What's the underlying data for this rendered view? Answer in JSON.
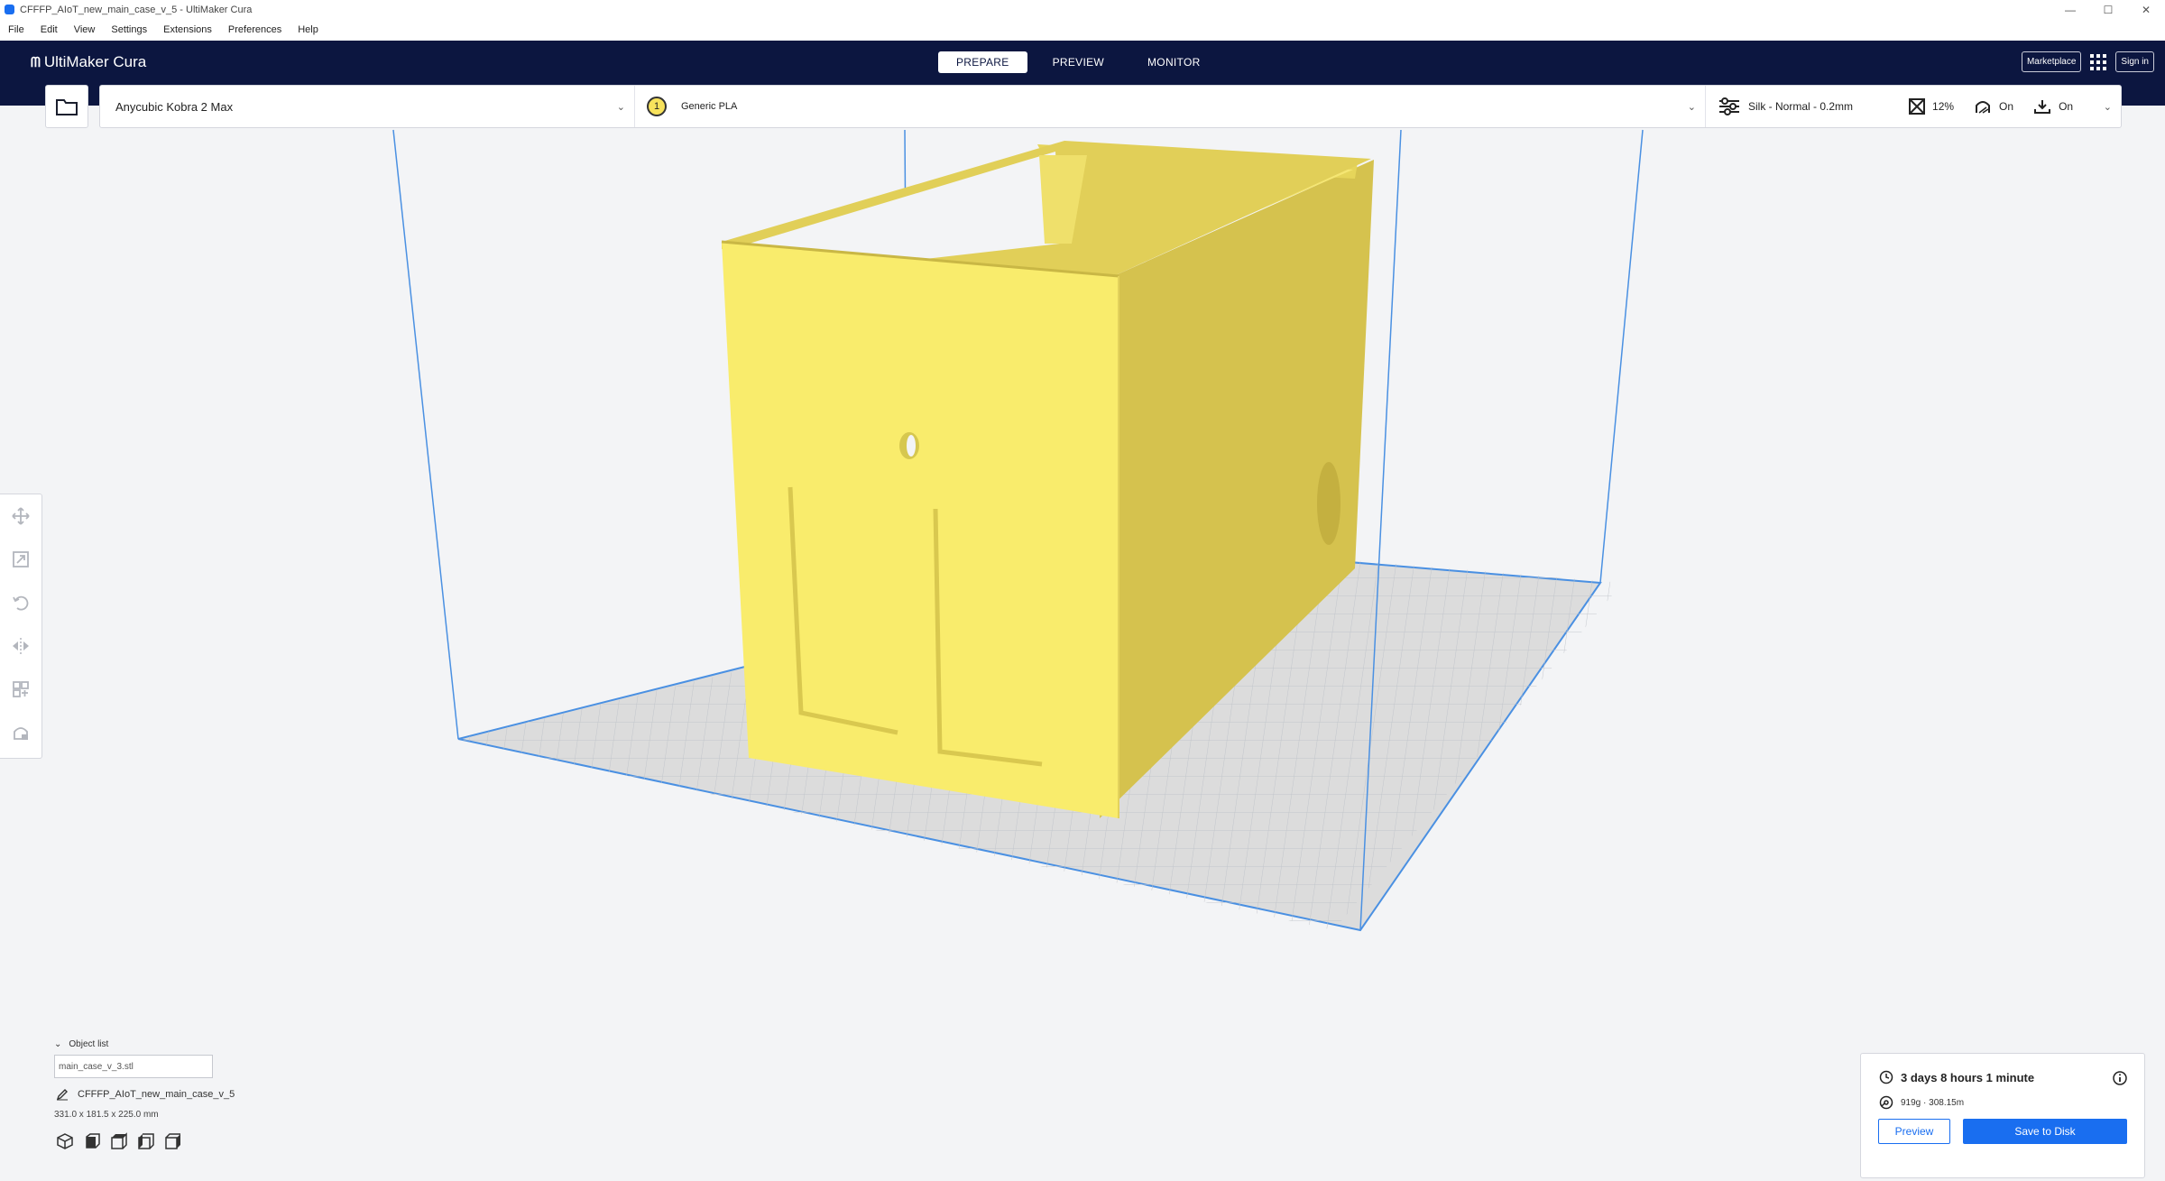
{
  "window": {
    "title": "CFFFP_AIoT_new_main_case_v_5 - UltiMaker Cura",
    "controls": [
      "—",
      "☐",
      "✕"
    ]
  },
  "menu": [
    "File",
    "Edit",
    "View",
    "Settings",
    "Extensions",
    "Preferences",
    "Help"
  ],
  "header": {
    "logo_text": "UltiMaker Cura",
    "stages": [
      "PREPARE",
      "PREVIEW",
      "MONITOR"
    ],
    "active_stage": "PREPARE",
    "marketplace_label": "Marketplace",
    "signin_label": "Sign in"
  },
  "toolbar": {
    "printer": "Anycubic Kobra 2 Max",
    "extruder_number": "1",
    "material": "Generic PLA",
    "profile": "Silk - Normal - 0.2mm",
    "infill": "12%",
    "support": "On",
    "adhesion": "On"
  },
  "object_list": {
    "label": "Object list",
    "item": "main_case_v_3.stl",
    "job_name": "CFFFP_AIoT_new_main_case_v_5",
    "dimensions": "331.0 x 181.5 x 225.0 mm"
  },
  "output": {
    "print_time": "3 days 8 hours 1 minute",
    "material_usage": "919g · 308.15m",
    "preview_label": "Preview",
    "save_label": "Save to Disk"
  },
  "colors": {
    "header_bg": "#0c1640",
    "accent": "#196ef0",
    "model_yellow": "#f8ea6a",
    "build_volume_line": "#4a90e2",
    "build_plate": "#d9d9d9"
  }
}
